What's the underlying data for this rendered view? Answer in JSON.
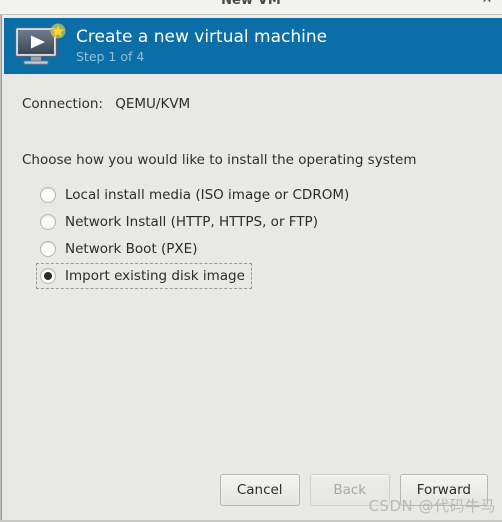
{
  "window": {
    "title": "New VM",
    "close_label": "✕"
  },
  "banner": {
    "title": "Create a new virtual machine",
    "subtitle": "Step 1 of 4",
    "icon": "monitor-play-star-icon",
    "background_color": "#0b6ea6",
    "title_color": "#ffffff",
    "subtitle_color": "#8fc0dc"
  },
  "connection": {
    "label": "Connection:",
    "value": "QEMU/KVM"
  },
  "install": {
    "prompt": "Choose how you would like to install the operating system",
    "options": [
      {
        "label": "Local install media (ISO image or CDROM)",
        "selected": false,
        "focused": false
      },
      {
        "label": "Network Install (HTTP, HTTPS, or FTP)",
        "selected": false,
        "focused": false
      },
      {
        "label": "Network Boot (PXE)",
        "selected": false,
        "focused": false
      },
      {
        "label": "Import existing disk image",
        "selected": true,
        "focused": true
      }
    ]
  },
  "footer": {
    "cancel_label": "Cancel",
    "back_label": "Back",
    "forward_label": "Forward",
    "back_disabled": true
  },
  "watermark": {
    "text": "CSDN @代码牛马"
  }
}
